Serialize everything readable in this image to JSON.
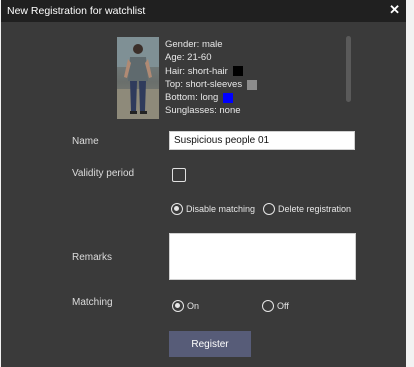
{
  "dialog": {
    "title": "New Registration for watchlist",
    "close_glyph": "✕"
  },
  "person": {
    "attributes": [
      {
        "label": "Gender: male",
        "swatch": null
      },
      {
        "label": "Age: 21-60",
        "swatch": null
      },
      {
        "label": "Hair: short-hair",
        "swatch": "#000000"
      },
      {
        "label": "Top: short-sleeves",
        "swatch": "#8c8c8c"
      },
      {
        "label": "Bottom: long",
        "swatch": "#0000ff"
      },
      {
        "label": "Sunglasses: none",
        "swatch": null
      }
    ]
  },
  "form": {
    "name_label": "Name",
    "name_value": "Suspicious people 01",
    "validity_label": "Validity period",
    "validity_checked": false,
    "option_disable": "Disable matching",
    "option_delete": "Delete registration",
    "option_selected": "Disable matching",
    "remarks_label": "Remarks",
    "remarks_value": "",
    "matching_label": "Matching",
    "matching_on": "On",
    "matching_off": "Off",
    "matching_selected": "On",
    "register_label": "Register"
  },
  "colors": {
    "dialog_bg": "#3a3a3a",
    "titlebar_bg": "#202020",
    "register_bg": "#575c78"
  }
}
